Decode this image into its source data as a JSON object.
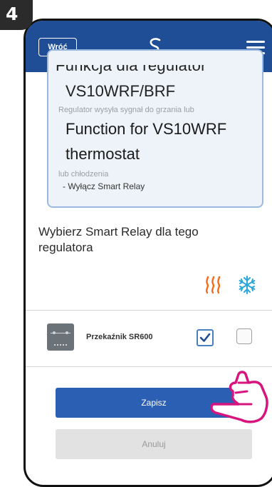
{
  "step": {
    "number": "4"
  },
  "header": {
    "back_label": "Wróć",
    "logo_icon": "s-logo-icon",
    "menu_icon": "hamburger-menu-icon",
    "color": "#1f4e96"
  },
  "card": {
    "cut_text": "Funkcja dla regulator",
    "model": "VS10WRF/BRF",
    "gray_line1": "Regulator wysyła sygnał do grzania lub",
    "function_line1": "Function for VS10WRF",
    "function_line2": "thermostat",
    "gray_line2": "lub chłodzenia",
    "bullet": "- Wyłącz Smart Relay"
  },
  "prompt": "Wybierz Smart Relay dla tego regulatora",
  "columns": {
    "heat_icon": "heating-icon",
    "cool_icon": "cooling-snowflake-icon",
    "heat_color": "#f26b1d",
    "cool_color": "#2aa7d6"
  },
  "relay": {
    "icon": "relay-device-icon",
    "label": "Przekaźnik SR600",
    "heating_checked": true,
    "cooling_checked": false
  },
  "buttons": {
    "save_label": "Zapisz",
    "cancel_label": "Anuluj"
  },
  "overlay": {
    "icon": "pointing-hand-icon",
    "color": "#d6157e"
  }
}
